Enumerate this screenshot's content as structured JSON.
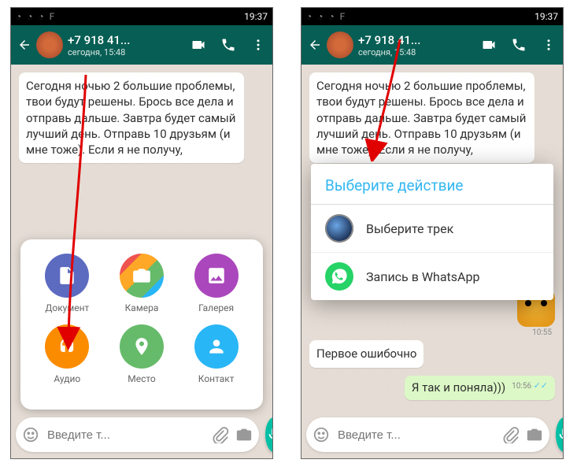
{
  "status": {
    "time": "19:37",
    "icons": "◔ ◔ ◔   F"
  },
  "header": {
    "contact_name": "+7 918 41...",
    "contact_sub": "сегодня, 15:48"
  },
  "message": {
    "text": "Сегодня ночью 2 большие проблемы, твои будут решены. Брось все дела и отправь дальше. Завтра будет самый лучший день. Отправь 10 друзьям (и мне тоже). Если я не получу,"
  },
  "attach": {
    "document": "Документ",
    "camera": "Камера",
    "gallery": "Галерея",
    "audio": "Аудио",
    "location": "Место",
    "contact": "Контакт"
  },
  "input": {
    "placeholder": "Введите т..."
  },
  "dialog": {
    "title": "Выберите действие",
    "item1": "Выберите трек",
    "item2": "Запись в WhatsApp"
  },
  "right_chat": {
    "sticker_time": "10:55",
    "msg1": "Первое ошибочно",
    "msg2": "Я так и поняла)))",
    "msg2_time": "10:56"
  }
}
